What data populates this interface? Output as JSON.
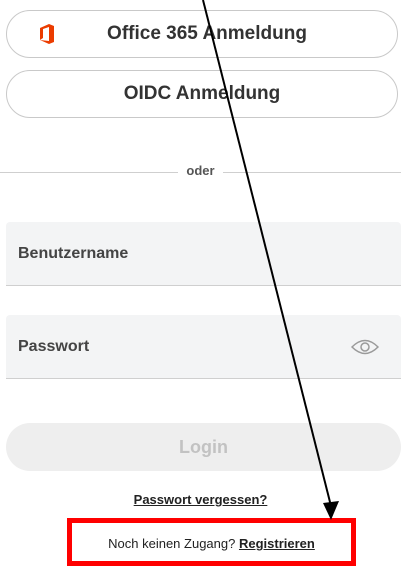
{
  "sso": {
    "office_label": "Office 365 Anmeldung",
    "oidc_label": "OIDC Anmeldung"
  },
  "divider": {
    "text": "oder"
  },
  "form": {
    "username_label": "Benutzername",
    "password_label": "Passwort",
    "login_label": "Login"
  },
  "links": {
    "forgot_password": "Passwort vergessen?",
    "no_account_prompt": "Noch keinen Zugang?",
    "register": "Registrieren"
  },
  "colors": {
    "office_brand": "#eb3c00",
    "annotation_red": "#ff0000",
    "field_bg": "#f3f4f5",
    "login_disabled_text": "#c2c2c2"
  },
  "icons": {
    "office": "office-logo-icon",
    "password_toggle": "eye-icon"
  }
}
